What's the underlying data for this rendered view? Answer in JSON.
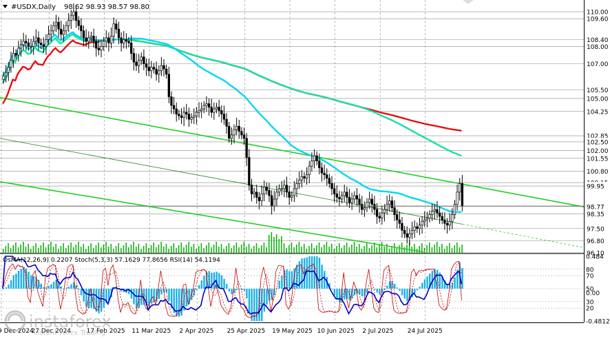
{
  "header": {
    "symbol": "#USDX,Daily",
    "ohlc": "98.62 98.93 98.57 98.80"
  },
  "oscillator_header": {
    "text": "OsMA(12,26,9) 0.2207  Stoch(5,3,3) 57.1629 77.8656  RSI(14) 54.1194"
  },
  "watermark": {
    "brand": "instaforex",
    "tagline": "Instant Forex Trading"
  },
  "colors": {
    "background": "#ffffff",
    "candle": "#000000",
    "ma_fast": "#00d8f0",
    "ma_mid": "#18e0a0",
    "ma_slow": "#e81010",
    "channel": "#20d020",
    "grid": "#8a8a8a",
    "osma_hist": "#1ab0e8",
    "stoch_main": "#c00000",
    "rsi": "#0000c0"
  },
  "chart_data": [
    {
      "type": "candlestick",
      "title": "#USDX,Daily",
      "x_tick_labels": [
        "9 Dec 2024",
        "27 Dec 2024",
        "17 Feb 2025",
        "11 Mar 2025",
        "2 Apr 2025",
        "25 Apr 2025",
        "19 May 2025",
        "10 Jun 2025",
        "2 Jul 2025",
        "24 Jul 2025"
      ],
      "y_tick_labels": [
        "110.00",
        "109.60",
        "108.40",
        "108.00",
        "107.00",
        "105.50",
        "105.00",
        "104.25",
        "102.85",
        "102.50",
        "102.00",
        "101.55",
        "100.80",
        "100.15",
        "99.95",
        "98.77",
        "98.35",
        "97.50",
        "96.80",
        "96.10"
      ],
      "ylim": [
        96.1,
        110.6
      ],
      "last_price": 98.8,
      "close_series": [
        106.3,
        106.5,
        106.8,
        107.2,
        107.6,
        107.5,
        107.9,
        108.1,
        108.3,
        108.2,
        108.0,
        108.0,
        108.3,
        108.5,
        108.2,
        108.1,
        108.0,
        108.4,
        108.7,
        108.9,
        109.2,
        109.4,
        109.0,
        108.7,
        108.9,
        109.2,
        109.5,
        109.8,
        110.0,
        109.5,
        109.2,
        108.9,
        108.5,
        108.3,
        108.5,
        108.6,
        108.3,
        107.9,
        107.8,
        108.0,
        108.3,
        108.5,
        108.2,
        108.6,
        109.3,
        109.0,
        108.5,
        108.2,
        108.4,
        108.3,
        108.2,
        107.6,
        107.1,
        106.9,
        107.2,
        107.4,
        107.0,
        106.8,
        106.6,
        106.8,
        106.7,
        106.4,
        106.6,
        106.9,
        106.7,
        106.4,
        105.1,
        104.6,
        104.4,
        104.1,
        104.0,
        103.9,
        104.2,
        104.1,
        103.8,
        103.9,
        104.0,
        104.2,
        104.3,
        104.4,
        104.6,
        104.7,
        104.5,
        104.2,
        104.4,
        104.5,
        104.3,
        104.1,
        103.8,
        103.4,
        102.7,
        102.9,
        103.2,
        103.4,
        103.1,
        102.9,
        102.7,
        101.6,
        100.0,
        99.5,
        99.6,
        99.3,
        99.1,
        99.5,
        99.9,
        99.7,
        99.4,
        98.8,
        99.2,
        99.6,
        99.8,
        99.8,
        100.0,
        99.6,
        99.3,
        99.4,
        99.8,
        100.1,
        100.3,
        100.5,
        100.4,
        100.6,
        101.1,
        101.4,
        101.7,
        101.4,
        101.0,
        100.7,
        100.6,
        100.4,
        100.1,
        99.8,
        99.5,
        99.3,
        99.2,
        99.4,
        99.6,
        99.3,
        99.0,
        99.2,
        99.4,
        99.2,
        98.9,
        98.6,
        98.7,
        99.0,
        99.2,
        98.9,
        98.6,
        98.2,
        98.1,
        98.4,
        98.6,
        98.9,
        99.1,
        98.7,
        98.3,
        98.0,
        97.8,
        97.4,
        97.2,
        97.0,
        97.2,
        97.4,
        97.6,
        97.5,
        97.7,
        97.9,
        98.0,
        98.1,
        98.3,
        98.5,
        98.6,
        98.4,
        98.2,
        98.0,
        97.8,
        97.7,
        97.9,
        98.3,
        98.9,
        99.6,
        100.1,
        98.8
      ]
    },
    {
      "type": "line",
      "title": "OsMA(12,26,9) 0.2207  Stoch(5,3,3) 57.1629 77.8656  RSI(14) 54.1194",
      "y_tick_labels": [
        "0.484",
        "80",
        "70",
        "50",
        "0.00",
        "30",
        "20",
        "-0.4812"
      ],
      "osma_ylim": [
        -0.4812,
        0.484
      ],
      "stoch_ylim": [
        0,
        100
      ]
    }
  ]
}
